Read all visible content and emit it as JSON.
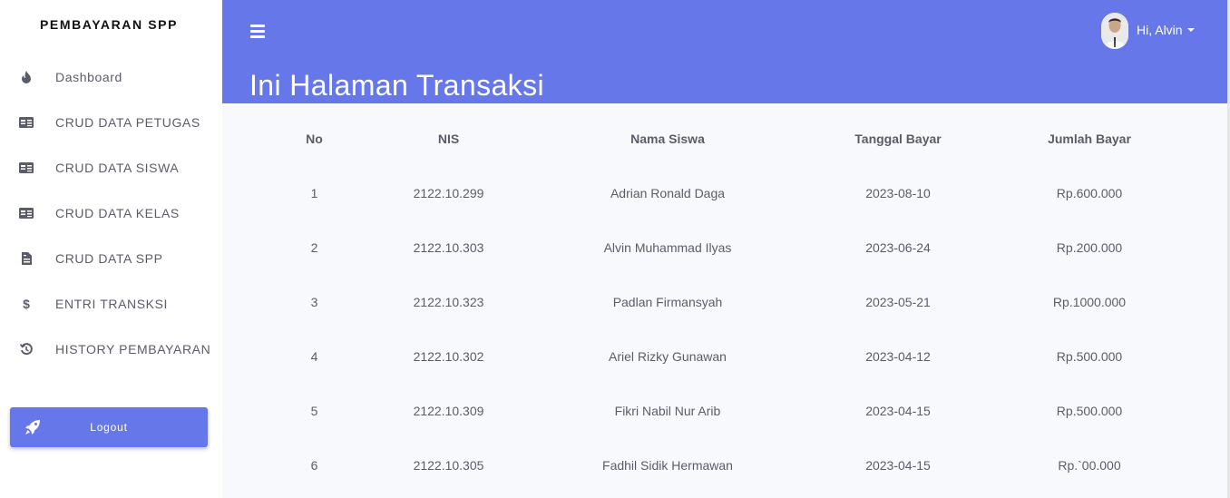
{
  "sidebar": {
    "brand": "PEMBAYARAN SPP",
    "items": [
      {
        "label": "Dashboard",
        "icon": "fire-icon"
      },
      {
        "label": "CRUD DATA PETUGAS",
        "icon": "id-card-icon"
      },
      {
        "label": "CRUD DATA SISWA",
        "icon": "id-card-icon"
      },
      {
        "label": "CRUD DATA KELAS",
        "icon": "id-card-icon"
      },
      {
        "label": "CRUD DATA SPP",
        "icon": "file-invoice-icon"
      },
      {
        "label": "ENTRI TRANSKSI",
        "icon": "dollar-icon"
      },
      {
        "label": "HISTORY PEMBAYARAN",
        "icon": "history-icon"
      }
    ],
    "logout_label": "Logout"
  },
  "header": {
    "title": "Ini Halaman Transaksi",
    "user_greeting": "Hi, Alvin"
  },
  "table": {
    "columns": [
      "No",
      "NIS",
      "Nama Siswa",
      "Tanggal Bayar",
      "Jumlah Bayar"
    ],
    "rows": [
      [
        "1",
        "2122.10.299",
        "Adrian Ronald Daga",
        "2023-08-10",
        "Rp.600.000"
      ],
      [
        "2",
        "2122.10.303",
        "Alvin Muhammad Ilyas",
        "2023-06-24",
        "Rp.200.000"
      ],
      [
        "3",
        "2122.10.323",
        "Padlan Firmansyah",
        "2023-05-21",
        "Rp.1000.000"
      ],
      [
        "4",
        "2122.10.302",
        "Ariel Rizky Gunawan",
        "2023-04-12",
        "Rp.500.000"
      ],
      [
        "5",
        "2122.10.309",
        "Fikri Nabil Nur Arib",
        "2023-04-15",
        "Rp.500.000"
      ],
      [
        "6",
        "2122.10.305",
        "Fadhil Sidik Hermawan",
        "2023-04-15",
        "Rp.`00.000"
      ]
    ]
  },
  "colors": {
    "accent": "#6677ea",
    "text": "#5a5c69"
  }
}
